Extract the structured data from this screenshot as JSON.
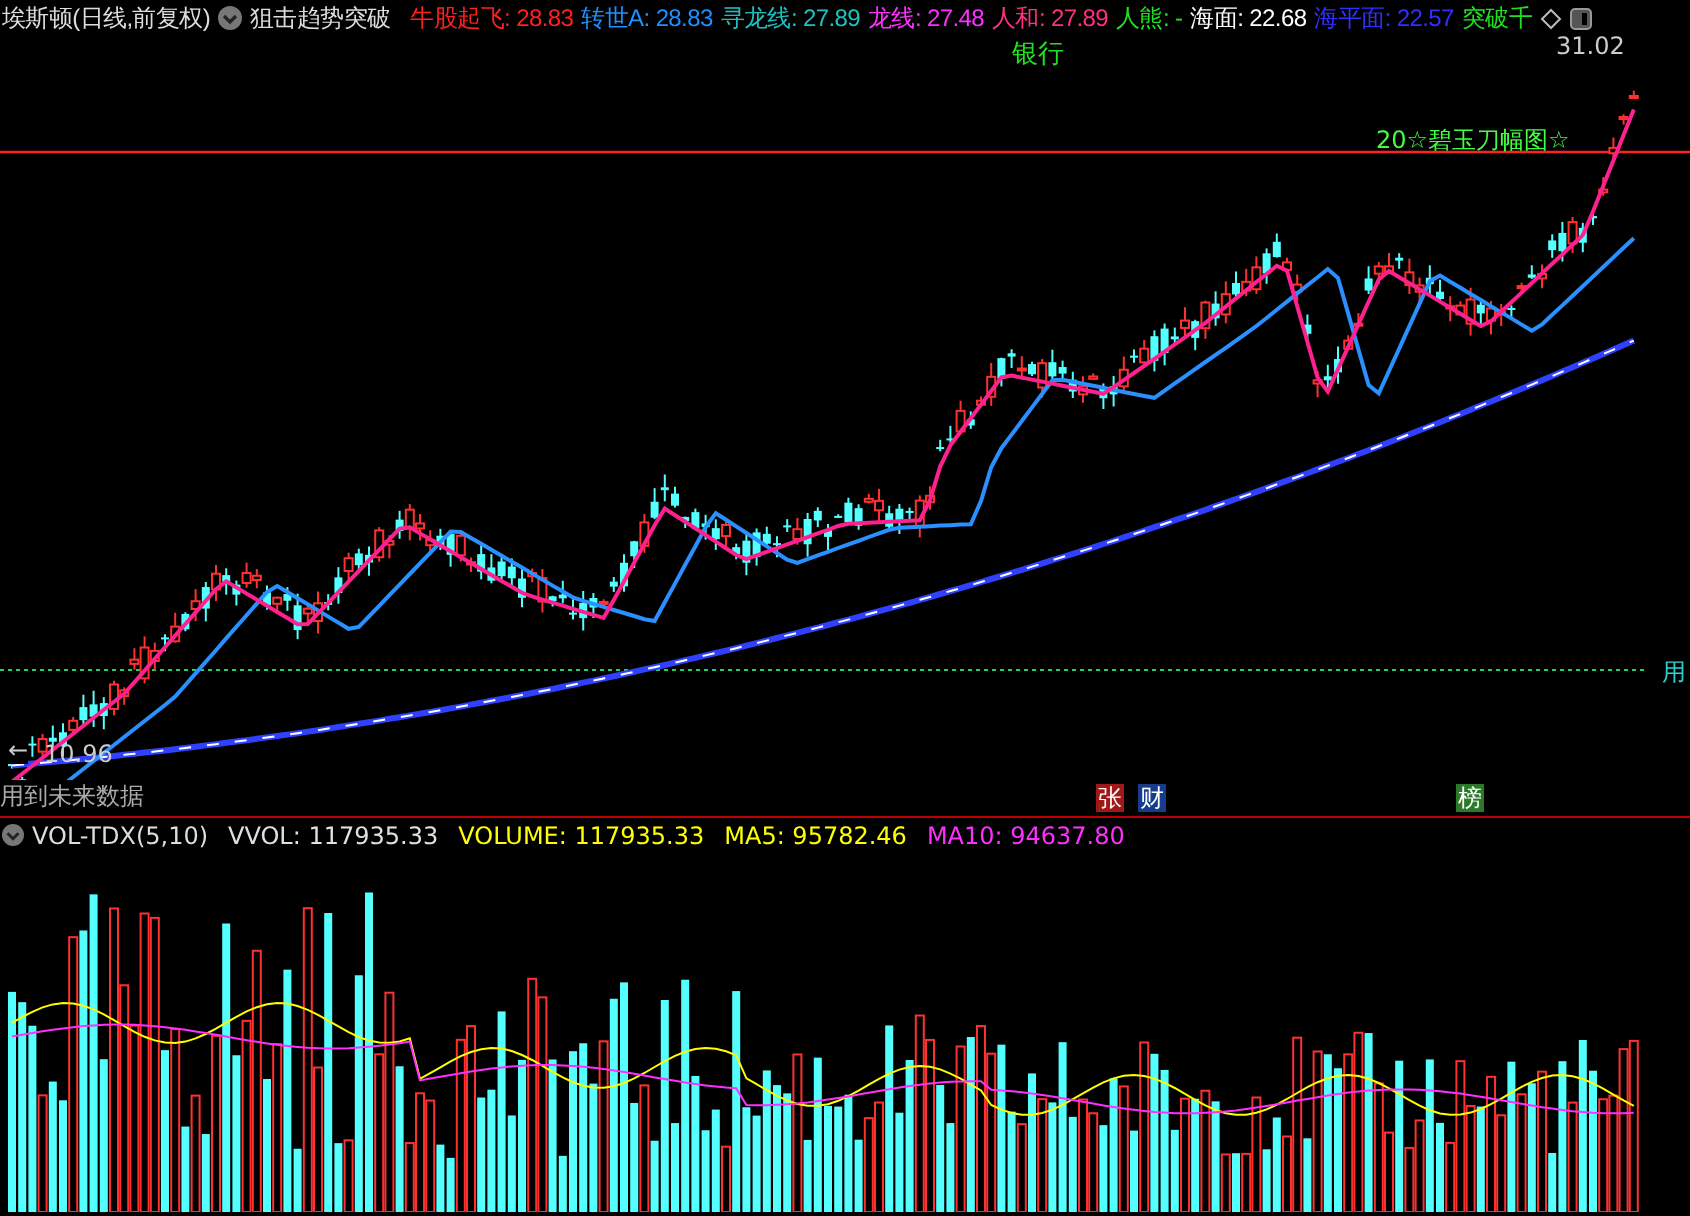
{
  "header": {
    "title": "埃斯顿(日线,前复权)",
    "indicator": "狙击趋势突破",
    "readings": [
      {
        "label": "牛股起飞:",
        "value": "28.83",
        "color": "#ff2020"
      },
      {
        "label": "转世A:",
        "value": "28.83",
        "color": "#1e90ff"
      },
      {
        "label": "寻龙线:",
        "value": "27.89",
        "color": "#20c0c0"
      },
      {
        "label": "龙线:",
        "value": "27.48",
        "color": "#ff30ff"
      },
      {
        "label": "人和:",
        "value": "27.89",
        "color": "#ff3080"
      },
      {
        "label": "人熊:",
        "value": "-",
        "color": "#20e020"
      },
      {
        "label": "海面:",
        "value": "22.68",
        "color": "#ffffff"
      },
      {
        "label": "海平面:",
        "value": "22.57",
        "color": "#3030ff"
      },
      {
        "label": "突破千",
        "color": "#20e020"
      }
    ]
  },
  "price_chart": {
    "sector_label": "银行",
    "high_price": "31.02",
    "signal_label": "20☆碧玉刀幅图☆",
    "low_price": "10.96",
    "low_arrow": "←",
    "warning": "用到未来数据",
    "edge_label": "用",
    "badges": [
      {
        "text": "张",
        "color": "#a01818"
      },
      {
        "text": "财",
        "color": "#183c8c"
      },
      {
        "text": "榜",
        "color": "#2a7a2a"
      }
    ]
  },
  "volume_chart": {
    "name": "VOL-TDX(5,10)",
    "readings": [
      {
        "label": "VVOL:",
        "value": "117935.33",
        "color": "#e0e0e0"
      },
      {
        "label": "VOLUME:",
        "value": "117935.33",
        "color": "#ffff00"
      },
      {
        "label": "MA5:",
        "value": "95782.46",
        "color": "#ffff00"
      },
      {
        "label": "MA10:",
        "value": "94637.80",
        "color": "#ff30ff"
      }
    ]
  }
}
